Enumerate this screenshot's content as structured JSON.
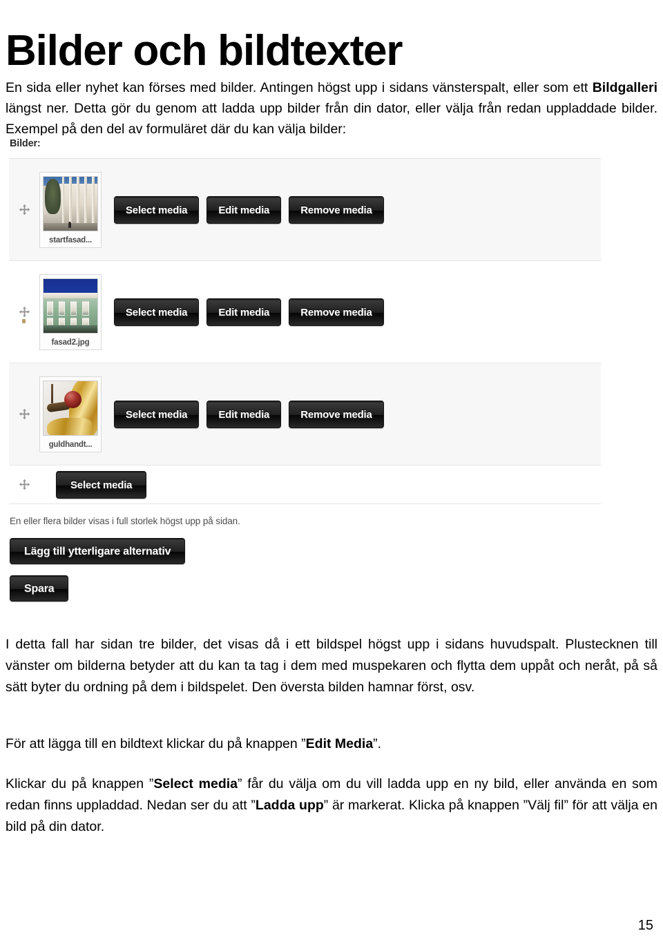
{
  "document": {
    "title": "Bilder och bildtexter",
    "page_number": "15"
  },
  "intro": {
    "part1": "En sida eller nyhet kan förses med bilder. Antingen högst upp i sidans vänsterspalt, eller som ett ",
    "bold1": "Bildgalleri",
    "part2": " längst ner. Detta gör du genom att ladda upp bilder från din dator, eller välja från redan uppladdade bilder. Exempel på den del av formuläret där du kan välja bilder:"
  },
  "form": {
    "field_label": "Bilder:",
    "help_text": "En eller flera bilder visas i full storlek högst upp på sidan.",
    "add_option_button": "Lägg till ytterligare alternativ",
    "save_button": "Spara",
    "buttons": {
      "select": "Select media",
      "edit": "Edit media",
      "remove": "Remove media"
    },
    "rows": [
      {
        "caption": "startfasad...",
        "art": "art-startfasad"
      },
      {
        "caption": "fasad2.jpg",
        "art": "art-fasad2"
      },
      {
        "caption": "guldhandt...",
        "art": "art-guldhandt"
      }
    ]
  },
  "body": {
    "p1": "I detta fall har sidan tre bilder, det visas då i ett bildspel högst upp i sidans huvudspalt. Plustecknen till vänster om bilderna betyder att du kan ta tag i dem med muspekaren och flytta dem uppåt och neråt, på så sätt byter du ordning på dem i bildspelet. Den översta bilden hamnar först, osv.",
    "p2_a": "För att lägga till en bildtext klickar du på knappen ”",
    "p2_b": "Edit Media",
    "p2_c": "”.",
    "p3_a": "Klickar du på knappen ”",
    "p3_b": "Select media",
    "p3_c": "” får du välja om du vill ladda upp en ny bild, eller använda en som redan finns uppladdad. Nedan ser du att ”",
    "p3_d": "Ladda upp",
    "p3_e": "” är markerat. Klicka på knappen ”Välj fil” för att välja en bild på din dator."
  },
  "colors": {
    "button_dark": "#1f1f1f",
    "row_alt": "#f7f7f7",
    "border": "#e6e6e6",
    "text": "#000000"
  }
}
